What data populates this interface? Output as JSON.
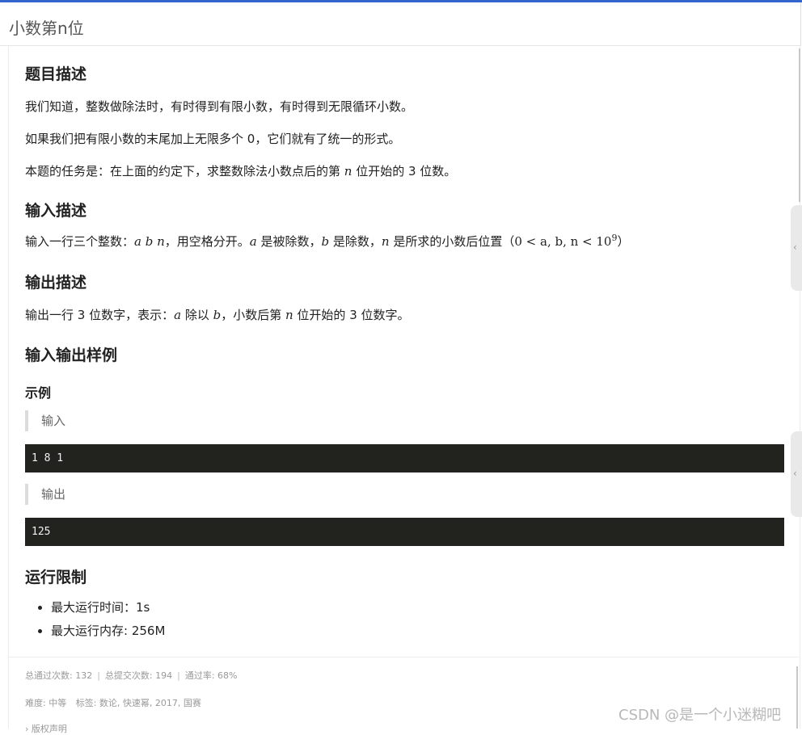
{
  "header": {
    "title": "小数第n位"
  },
  "description": {
    "heading": "题目描述",
    "p1": "我们知道，整数做除法时，有时得到有限小数，有时得到无限循环小数。",
    "p2": "如果我们把有限小数的末尾加上无限多个 0，它们就有了统一的形式。",
    "p3_pre": "本题的任务是：在上面的约定下，求整数除法小数点后的第 ",
    "p3_var": "n",
    "p3_post": " 位开始的 3 位数。"
  },
  "input": {
    "heading": "输入描述",
    "t1": "输入一行三个整数：",
    "v1": "a b n",
    "t2": "，用空格分开。",
    "v2": "a",
    "t3": " 是被除数，",
    "v3": "b",
    "t4": " 是除数，",
    "v4": "n",
    "t5": " 是所求的小数后位置（",
    "range": "0 < a, b, n < 10",
    "exp": "9",
    "t6": "）"
  },
  "output": {
    "heading": "输出描述",
    "t1": "输出一行 3 位数字，表示：",
    "v1": "a",
    "t2": " 除以 ",
    "v2": "b",
    "t3": "，小数后第 ",
    "v3": "n",
    "t4": " 位开始的 3 位数字。"
  },
  "samples": {
    "heading": "输入输出样例",
    "example_label": "示例",
    "input_label": "输入",
    "input_code": "1 8 1",
    "output_label": "输出",
    "output_code": "125"
  },
  "limits": {
    "heading": "运行限制",
    "time": "最大运行时间：1s",
    "memory": "最大运行内存: 256M"
  },
  "stats": {
    "passed": "总通过次数: 132",
    "submitted": "总提交次数: 194",
    "rate": "通过率: 68%"
  },
  "tags": {
    "difficulty": "难度: 中等",
    "labels": "标签: 数论, 快速幂, 2017, 国赛"
  },
  "copyright": "› 版权声明",
  "watermark": "CSDN @是一个小迷糊吧",
  "icons": {
    "collapse": "chevron-left-icon"
  }
}
